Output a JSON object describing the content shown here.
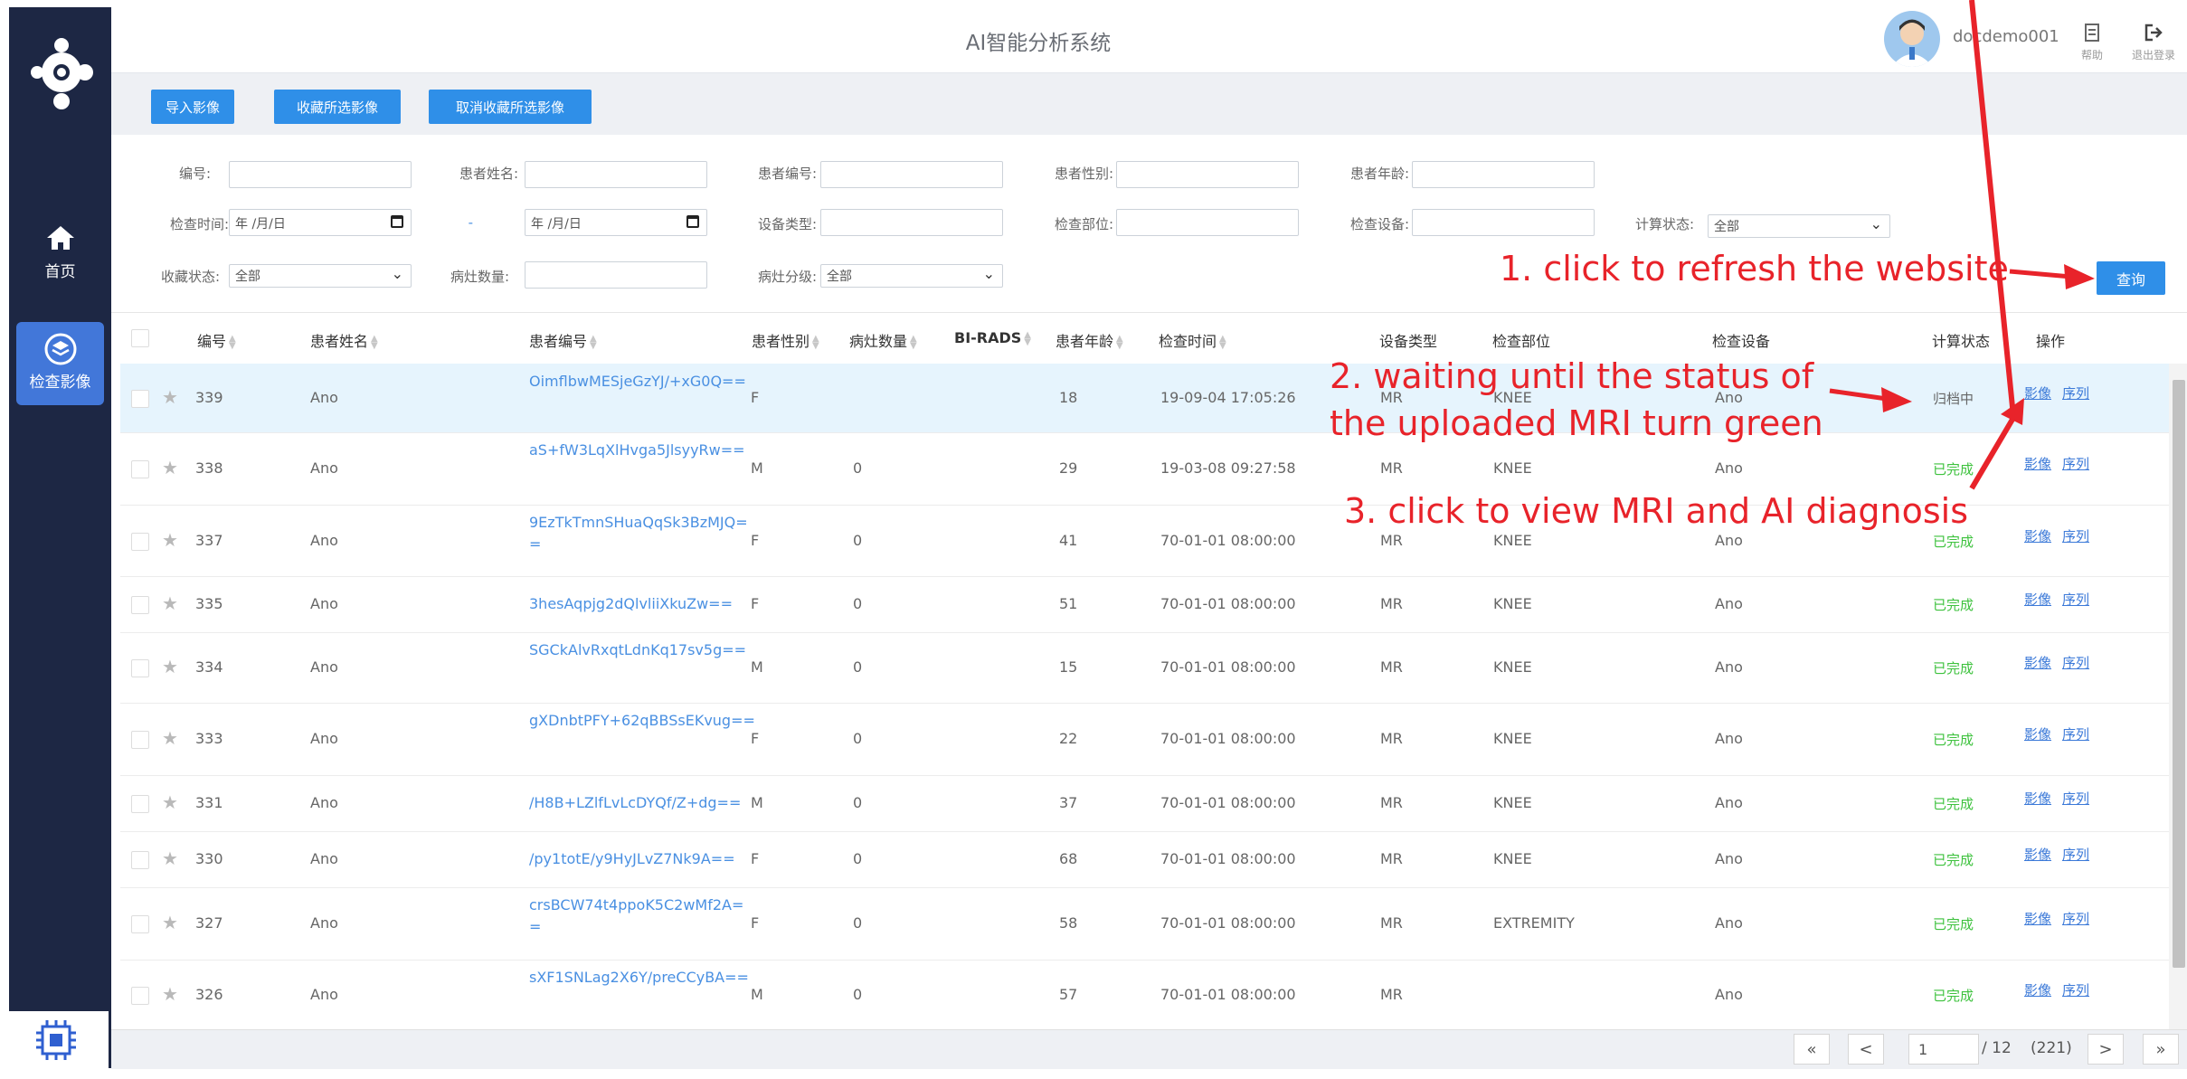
{
  "sidebar": {
    "nav": [
      {
        "label": "首页",
        "icon": "home-icon"
      },
      {
        "label": "检查影像",
        "icon": "layers-icon",
        "active": true
      }
    ]
  },
  "header": {
    "title": "AI智能分析系统",
    "username": "docdemo001",
    "help_label": "帮助",
    "logout_label": "退出登录"
  },
  "toolbar": {
    "import_label": "导入影像",
    "favorite_label": "收藏所选影像",
    "unfavorite_label": "取消收藏所选影像"
  },
  "filters": {
    "id_label": "编号:",
    "patient_name_label": "患者姓名:",
    "patient_no_label": "患者编号:",
    "gender_label": "患者性别:",
    "age_label": "患者年龄:",
    "exam_time_label": "检查时间:",
    "date_placeholder_from": "年 /月/日",
    "date_sep": "-",
    "date_placeholder_to": "年 /月/日",
    "device_type_label": "设备类型:",
    "body_part_label": "检查部位:",
    "device_label": "检查设备:",
    "calc_status_label": "计算状态:",
    "calc_status_value": "全部",
    "fav_status_label": "收藏状态:",
    "fav_status_value": "全部",
    "lesion_count_label": "病灶数量:",
    "lesion_grade_label": "病灶分级:",
    "lesion_grade_value": "全部",
    "search_label": "查询"
  },
  "table": {
    "headers": {
      "id": "编号",
      "name": "患者姓名",
      "patient_no": "患者编号",
      "gender": "患者性别",
      "lesion_count": "病灶数量",
      "birads": "BI-RADS",
      "age": "患者年龄",
      "exam_time": "检查时间",
      "device_type": "设备类型",
      "body_part": "检查部位",
      "device": "检查设备",
      "status": "计算状态",
      "ops": "操作"
    },
    "rows": [
      {
        "id": "339",
        "name": "Ano",
        "patient_no": "OimflbwMESjeGzYJ/+xG0Q==",
        "gender": "F",
        "lesion_count": "",
        "age": "18",
        "exam_time": "19-09-04 17:05:26",
        "device_type": "MR",
        "body_part": "KNEE",
        "device": "Ano",
        "status": "归档中",
        "done": false,
        "op1": "影像",
        "op2": "序列"
      },
      {
        "id": "338",
        "name": "Ano",
        "patient_no": "aS+fW3LqXlHvga5JlsyyRw==",
        "gender": "M",
        "lesion_count": "0",
        "age": "29",
        "exam_time": "19-03-08 09:27:58",
        "device_type": "MR",
        "body_part": "KNEE",
        "device": "Ano",
        "status": "已完成",
        "done": true,
        "op1": "影像",
        "op2": "序列"
      },
      {
        "id": "337",
        "name": "Ano",
        "patient_no": "9EzTkTmnSHuaQqSk3BzMJQ==",
        "gender": "F",
        "lesion_count": "0",
        "age": "41",
        "exam_time": "70-01-01 08:00:00",
        "device_type": "MR",
        "body_part": "KNEE",
        "device": "Ano",
        "status": "已完成",
        "done": true,
        "op1": "影像",
        "op2": "序列"
      },
      {
        "id": "335",
        "name": "Ano",
        "patient_no": "3hesAqpjg2dQlvliiXkuZw==",
        "gender": "F",
        "lesion_count": "0",
        "age": "51",
        "exam_time": "70-01-01 08:00:00",
        "device_type": "MR",
        "body_part": "KNEE",
        "device": "Ano",
        "status": "已完成",
        "done": true,
        "op1": "影像",
        "op2": "序列"
      },
      {
        "id": "334",
        "name": "Ano",
        "patient_no": "SGCkAlvRxqtLdnKq17sv5g==",
        "gender": "M",
        "lesion_count": "0",
        "age": "15",
        "exam_time": "70-01-01 08:00:00",
        "device_type": "MR",
        "body_part": "KNEE",
        "device": "Ano",
        "status": "已完成",
        "done": true,
        "op1": "影像",
        "op2": "序列"
      },
      {
        "id": "333",
        "name": "Ano",
        "patient_no": "gXDnbtPFY+62qBBSsEKvug==",
        "gender": "F",
        "lesion_count": "0",
        "age": "22",
        "exam_time": "70-01-01 08:00:00",
        "device_type": "MR",
        "body_part": "KNEE",
        "device": "Ano",
        "status": "已完成",
        "done": true,
        "op1": "影像",
        "op2": "序列"
      },
      {
        "id": "331",
        "name": "Ano",
        "patient_no": "/H8B+LZlfLvLcDYQf/Z+dg==",
        "gender": "M",
        "lesion_count": "0",
        "age": "37",
        "exam_time": "70-01-01 08:00:00",
        "device_type": "MR",
        "body_part": "KNEE",
        "device": "Ano",
        "status": "已完成",
        "done": true,
        "op1": "影像",
        "op2": "序列"
      },
      {
        "id": "330",
        "name": "Ano",
        "patient_no": "/py1totE/y9HyJLvZ7Nk9A==",
        "gender": "F",
        "lesion_count": "0",
        "age": "68",
        "exam_time": "70-01-01 08:00:00",
        "device_type": "MR",
        "body_part": "KNEE",
        "device": "Ano",
        "status": "已完成",
        "done": true,
        "op1": "影像",
        "op2": "序列"
      },
      {
        "id": "327",
        "name": "Ano",
        "patient_no": "crsBCW74t4ppoK5C2wMf2A==",
        "gender": "F",
        "lesion_count": "0",
        "age": "58",
        "exam_time": "70-01-01 08:00:00",
        "device_type": "MR",
        "body_part": "EXTREMITY",
        "device": "Ano",
        "status": "已完成",
        "done": true,
        "op1": "影像",
        "op2": "序列"
      },
      {
        "id": "326",
        "name": "Ano",
        "patient_no": "sXF1SNLag2X6Y/preCCyBA==",
        "gender": "M",
        "lesion_count": "0",
        "age": "57",
        "exam_time": "70-01-01 08:00:00",
        "device_type": "MR",
        "body_part": "",
        "device": "Ano",
        "status": "已完成",
        "done": true,
        "op1": "影像",
        "op2": "序列"
      }
    ]
  },
  "pagination": {
    "first": "«",
    "prev": "<",
    "page_value": "1",
    "total_pages": "/ 12",
    "total_count": "(221)",
    "next": ">",
    "last": "»"
  },
  "annotations": {
    "step1": "1. click to refresh the website",
    "step2_line1": "2. waiting until the status of",
    "step2_line2": "the uploaded MRI turn green",
    "step3": "3. click to view MRI and AI diagnosis",
    "color": "#e8232a"
  },
  "colors": {
    "sidebar_bg": "#1d2744",
    "sidebar_active": "#4277d9",
    "primary_button": "#2f8fe8",
    "status_done": "#3ec23e",
    "link": "#4a90e2"
  }
}
